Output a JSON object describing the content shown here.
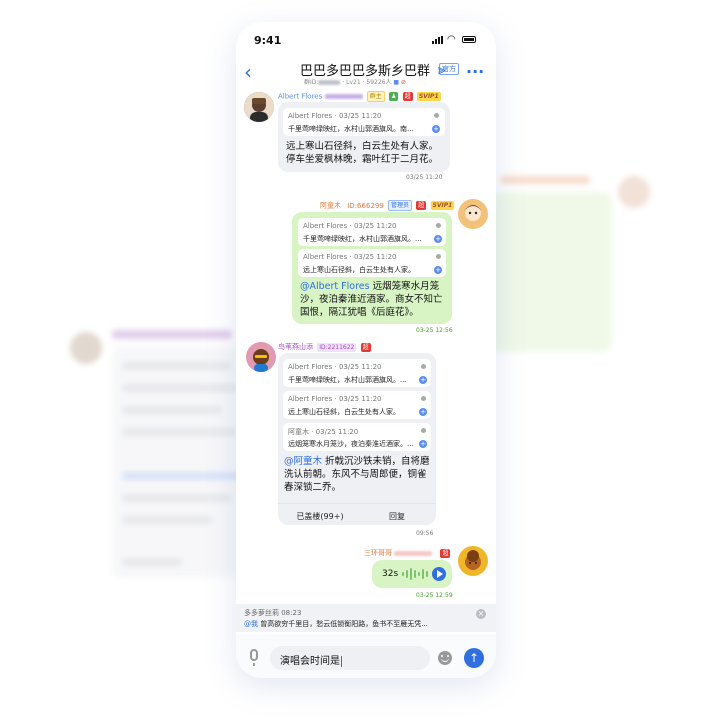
{
  "status": {
    "time": "9:41"
  },
  "header": {
    "title": "巴巴多巴巴多斯乡巴群",
    "badge": "官方",
    "sub_prefix": "群ID:",
    "sub_suffix": "· Lv21 · 59226人"
  },
  "messages": {
    "m1": {
      "name": "Albert Flores",
      "level_tag": "SVIP1",
      "owner_tag": "群主",
      "red_tag": "超",
      "quote": {
        "header": "Albert Flores · 03/25 11:20",
        "text": "千里莺啼绿映红，水村山郭酒旗风。南..."
      },
      "text": "远上寒山石径斜，白云生处有人家。停车坐爱枫林晚，霜叶红于二月花。",
      "time": "03/25 11:20"
    },
    "m2": {
      "name": "阿童木",
      "id": "ID:666299",
      "role_tag": "管理员",
      "red_tag": "超",
      "level_tag": "SVIP1",
      "quote1": {
        "header": "Albert Flores · 03/25 11:20",
        "text": "千里莺啼绿映红，水村山郭酒旗风。..."
      },
      "quote2": {
        "header": "Albert Flores · 03/25 11:20",
        "text": "远上寒山石径斜，白云生处有人家。"
      },
      "mention": "@Albert Flores",
      "text": " 远烟笼寒水月笼沙，夜泊秦淮近酒家。商女不知亡国恨，隔江犹唱《后庭花》。",
      "time": "03-25 12:56"
    },
    "m3": {
      "name": "鸟苇燕山添",
      "id": "ID:2211622",
      "red_tag": "超",
      "quote1": {
        "header": "Albert Flores · 03/25 11:20",
        "text": "千里莺啼绿映红，水村山郭酒旗风。..."
      },
      "quote2": {
        "header": "Albert Flores · 03/25 11:20",
        "text": "远上寒山石径斜，白云生处有人家。"
      },
      "quote3": {
        "header": "阿童木 · 03/25 11:20",
        "text": "远烟笼寒水月笼沙，夜泊秦淮近酒家。..."
      },
      "mention": "@阿童木",
      "text": " 折戟沉沙铁未销，自将磨洗认前朝。东风不与周郎便，铜雀春深锁二乔。",
      "action_left": "已盖楼(99+)",
      "action_right": "回复",
      "time": "09:56"
    },
    "m4": {
      "name": "三环哥哥",
      "red_tag": "超",
      "duration": "32s",
      "time": "03-25 12:59"
    }
  },
  "reply": {
    "header": "多多萝丝莉 08:23",
    "at": "@我",
    "text": " 曾高欲穷千里目，愁云低锁衡阳路，鱼书不至雁无凭..."
  },
  "input": {
    "value": "演唱会时间是"
  },
  "colors": {
    "accent": "#2f6fe0",
    "green_bubble": "#d8f4c4",
    "gray_bubble": "#eef0f4"
  }
}
